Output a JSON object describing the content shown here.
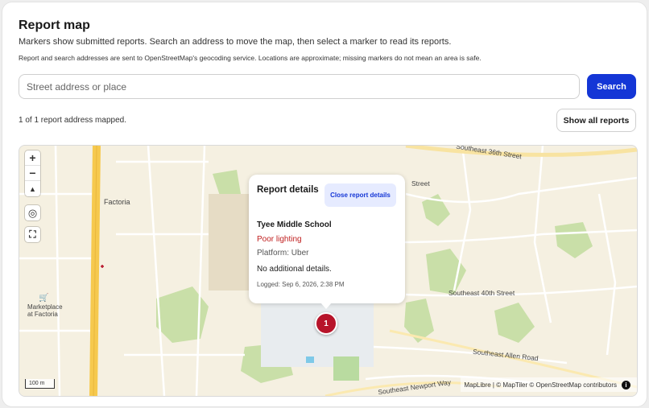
{
  "header": {
    "title": "Report map",
    "description": "Markers show submitted reports. Search an address to move the map, then select a marker to read its reports.",
    "note": "Report and search addresses are sent to OpenStreetMap's geocoding service. Locations are approximate; missing markers do not mean an area is safe."
  },
  "search": {
    "placeholder": "Street address or place",
    "value": "",
    "button_label": "Search"
  },
  "status_text": "1 of 1 report address mapped.",
  "show_all_label": "Show all reports",
  "map": {
    "controls": {
      "zoom_in": "+",
      "zoom_out": "−",
      "compass": "▲",
      "locate": "◎",
      "fullscreen": "⛶"
    },
    "place_labels": {
      "factoria": "Factoria",
      "marketplace_line1": "Marketplace",
      "marketplace_line2": "at Factoria"
    },
    "street_labels": {
      "se36": "Southeast 36th Street",
      "street_partial": "Street",
      "se40": "Southeast 40th Street",
      "se_allen": "Southeast Allen Road",
      "se_newport": "Southeast Newport Way"
    },
    "scale_label": "100 m",
    "attribution": "MapLibre | © MapTiler © OpenStreetMap contributors",
    "info_icon": "i",
    "marker_count": "1"
  },
  "popup": {
    "title": "Report details",
    "close_label": "Close report details",
    "school": "Tyee Middle School",
    "category": "Poor lighting",
    "platform": "Platform: Uber",
    "details": "No additional details.",
    "logged": "Logged: Sep 6, 2026, 2:38 PM"
  },
  "colors": {
    "accent": "#1436d6",
    "marker": "#b7142a",
    "category_text": "#c02020",
    "map_land": "#f5f0e1",
    "map_park": "#c9dfa8",
    "map_highway": "#f6c94e"
  }
}
